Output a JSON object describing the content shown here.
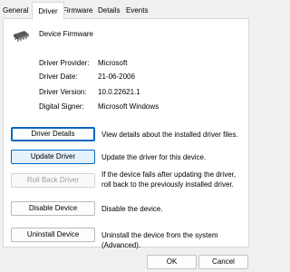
{
  "tabs": [
    "General",
    "Driver",
    "Firmware",
    "Details",
    "Events"
  ],
  "device": {
    "name": "Device Firmware"
  },
  "info": [
    {
      "label": "Driver Provider:",
      "value": "Microsoft"
    },
    {
      "label": "Driver Date:",
      "value": "21-06-2006"
    },
    {
      "label": "Driver Version:",
      "value": "10.0.22621.1"
    },
    {
      "label": "Digital Signer:",
      "value": "Microsoft Windows"
    }
  ],
  "actions": [
    {
      "label": "Driver Details",
      "desc": "View details about the installed driver files."
    },
    {
      "label": "Update Driver",
      "desc": "Update the driver for this device."
    },
    {
      "label": "Roll Back Driver",
      "desc": "If the device fails after updating the driver, roll back to the previously installed driver."
    },
    {
      "label": "Disable Device",
      "desc": "Disable the device."
    },
    {
      "label": "Uninstall Device",
      "desc": "Uninstall the device from the system (Advanced)."
    }
  ],
  "footer": {
    "ok": "OK",
    "cancel": "Cancel"
  },
  "icons": {
    "device": "chip-icon"
  }
}
